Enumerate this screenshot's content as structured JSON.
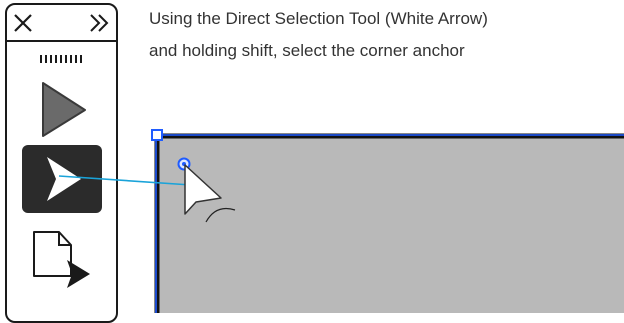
{
  "instruction": {
    "line1": "Using the Direct Selection Tool (White Arrow)",
    "line2": "and holding shift, select the corner anchor"
  },
  "toolbar": {
    "close_icon": "close-icon",
    "expand_icon": "double-chevron-right-icon",
    "grip_icon": "grip-icon",
    "tools": [
      {
        "name": "selection-tool",
        "icon": "black-arrow-icon",
        "active": false
      },
      {
        "name": "direct-selection-tool",
        "icon": "white-arrow-icon",
        "active": true
      },
      {
        "name": "page-tool",
        "icon": "page-arrow-icon",
        "active": false
      }
    ]
  },
  "colors": {
    "accent_blue": "#1aa3d9",
    "selection_blue": "#1f5cff",
    "shape_fill": "#b9b9b9",
    "active_tool_bg": "#2b2b2b",
    "tool_gray": "#6a6a6a"
  }
}
